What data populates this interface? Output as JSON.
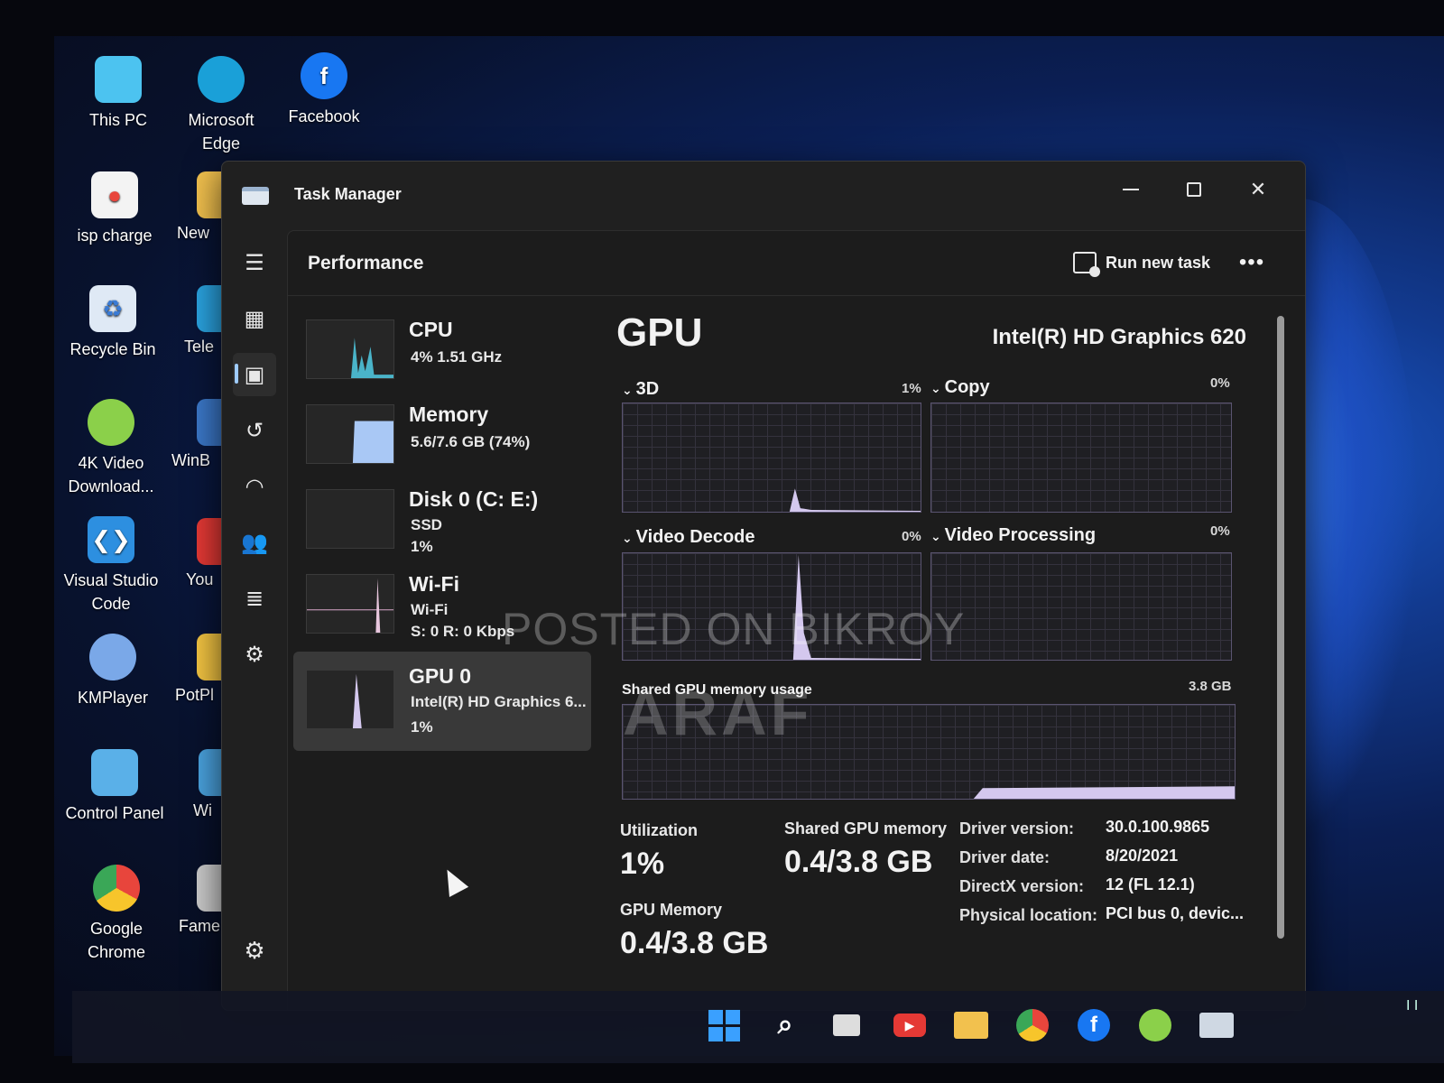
{
  "desktop": {
    "icons": [
      {
        "label": "This PC",
        "icon": "monitor-icon",
        "color": "#4cc3f0"
      },
      {
        "label": "Microsoft Edge",
        "icon": "edge-icon",
        "color": "#1aa0d8"
      },
      {
        "label": "Facebook",
        "icon": "facebook-icon",
        "color": "#1877f2"
      },
      {
        "label": "isp charge",
        "icon": "chrome-doc-icon",
        "color": "#f3f3f3"
      },
      {
        "label": "Recycle Bin",
        "icon": "recycle-bin-icon",
        "color": "#dfe9f5"
      },
      {
        "label": "4K Video Download...",
        "icon": "4k-video-icon",
        "color": "#8bd04a"
      },
      {
        "label": "Visual Studio Code",
        "icon": "vscode-icon",
        "color": "#2d8fe0"
      },
      {
        "label": "KMPlayer",
        "icon": "kmplayer-icon",
        "color": "#7aa8e8"
      },
      {
        "label": "Control Panel",
        "icon": "control-panel-icon",
        "color": "#5ab0e8"
      },
      {
        "label": "Google Chrome",
        "icon": "chrome-icon",
        "color": "#e8453c"
      }
    ],
    "partial_icons": [
      {
        "label": "New",
        "icon": "folder-icon",
        "color": "#f2c14e"
      },
      {
        "label": "Tele",
        "icon": "telegram-icon",
        "color": "#2aa3e0"
      },
      {
        "label": "WinB",
        "icon": "winbox-icon",
        "color": "#3b78c9"
      },
      {
        "label": "You",
        "icon": "youtube-icon",
        "color": "#e53935"
      },
      {
        "label": "PotPl",
        "icon": "potplayer-icon",
        "color": "#f4c542"
      },
      {
        "label": "Wi",
        "icon": "app-icon",
        "color": "#4aa3df"
      },
      {
        "label": "Fame",
        "icon": "app-icon",
        "color": "#cccccc"
      }
    ]
  },
  "window": {
    "title": "Task Manager",
    "page_title": "Performance",
    "run_new_task": "Run new task",
    "more": "•••"
  },
  "perf_list": [
    {
      "name": "CPU",
      "lines": [
        "4%  1.51 GHz"
      ]
    },
    {
      "name": "Memory",
      "lines": [
        "5.6/7.6 GB (74%)"
      ]
    },
    {
      "name": "Disk 0 (C: E:)",
      "lines": [
        "SSD",
        "1%"
      ]
    },
    {
      "name": "Wi-Fi",
      "lines": [
        "Wi-Fi",
        "S: 0  R: 0 Kbps"
      ]
    },
    {
      "name": "GPU 0",
      "lines": [
        "Intel(R) HD Graphics 6...",
        "1%"
      ]
    }
  ],
  "gpu": {
    "title": "GPU",
    "model": "Intel(R) HD Graphics 620",
    "engines": [
      {
        "label": "3D",
        "pct": "1%"
      },
      {
        "label": "Copy",
        "pct": "0%"
      },
      {
        "label": "Video Decode",
        "pct": "0%"
      },
      {
        "label": "Video Processing",
        "pct": "0%"
      }
    ],
    "shared_label": "Shared GPU memory usage",
    "shared_max": "3.8 GB",
    "stats": {
      "utilization_label": "Utilization",
      "utilization_value": "1%",
      "shared_mem_label": "Shared GPU memory",
      "shared_mem_value": "0.4/3.8 GB",
      "gpu_mem_label": "GPU Memory",
      "gpu_mem_value": "0.4/3.8 GB"
    },
    "info": [
      {
        "key": "Driver version:",
        "value": "30.0.100.9865"
      },
      {
        "key": "Driver date:",
        "value": "8/20/2021"
      },
      {
        "key": "DirectX version:",
        "value": "12 (FL 12.1)"
      },
      {
        "key": "Physical location:",
        "value": "PCI bus 0, devic..."
      }
    ]
  },
  "watermark": {
    "line1": "POSTED ON BIKROY",
    "line2": "ARAF"
  },
  "taskbar": [
    {
      "name": "start-button",
      "icon": "windows-icon",
      "color": "#3aa0ff"
    },
    {
      "name": "search-button",
      "icon": "search-icon",
      "color": "#ffffff"
    },
    {
      "name": "task-view-button",
      "icon": "task-view-icon",
      "color": "#dddddd"
    },
    {
      "name": "youtube-button",
      "icon": "youtube-icon",
      "color": "#e53935"
    },
    {
      "name": "file-explorer-button",
      "icon": "folder-icon",
      "color": "#f2c14e"
    },
    {
      "name": "chrome-button",
      "icon": "chrome-icon",
      "color": "#e8453c"
    },
    {
      "name": "facebook-button",
      "icon": "facebook-icon",
      "color": "#1877f2"
    },
    {
      "name": "4k-video-button",
      "icon": "4k-video-icon",
      "color": "#8bd04a"
    },
    {
      "name": "task-manager-button",
      "icon": "task-manager-icon",
      "color": "#cfd8e3"
    }
  ],
  "tray": "I I"
}
